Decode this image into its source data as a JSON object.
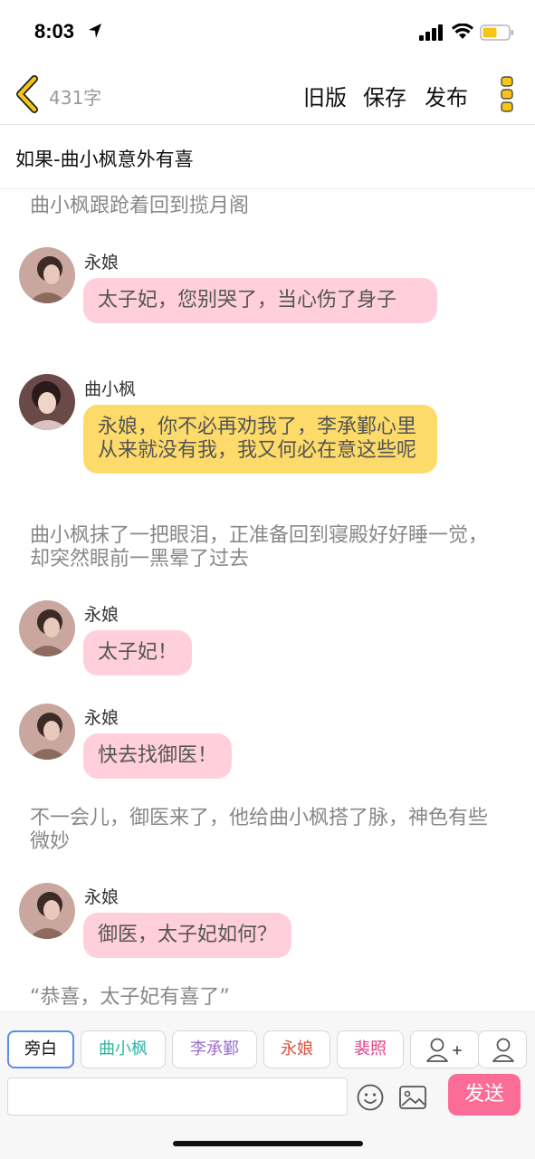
{
  "status": {
    "time": "8:03",
    "battery_color": "#f5c518"
  },
  "header": {
    "word_count": "431字",
    "old_version": "旧版",
    "save": "保存",
    "publish": "发布",
    "accent": "#f5c518"
  },
  "story": {
    "title": "如果-曲小枫意外有喜"
  },
  "chat": [
    {
      "type": "narration",
      "text": "曲小枫跟跄着回到揽月阁"
    },
    {
      "type": "message",
      "speaker": "永娘",
      "text": "太子妃，您别哭了，当心伤了身子",
      "color": "#ffd0db"
    },
    {
      "type": "message",
      "speaker": "曲小枫",
      "text": "永娘，你不必再劝我了，李承鄞心里从来就没有我，我又何必在意这些呢",
      "color": "#fddb6a"
    },
    {
      "type": "narration",
      "text": "曲小枫抹了一把眼泪，正准备回到寝殿好好睡一觉，却突然眼前一黑晕了过去"
    },
    {
      "type": "message",
      "speaker": "永娘",
      "text": "太子妃！",
      "color": "#ffd0db"
    },
    {
      "type": "message",
      "speaker": "永娘",
      "text": "快去找御医！",
      "color": "#ffd0db"
    },
    {
      "type": "narration",
      "text": "不一会儿，御医来了，他给曲小枫搭了脉，神色有些微妙"
    },
    {
      "type": "message",
      "speaker": "永娘",
      "text": "御医，太子妃如何？",
      "color": "#ffd0db"
    },
    {
      "type": "narration",
      "text": "“恭喜，太子妃有喜了”"
    }
  ],
  "roles": [
    {
      "label": "旁白",
      "color": "#111111",
      "active": true
    },
    {
      "label": "曲小枫",
      "color": "#2bb5a0",
      "active": false
    },
    {
      "label": "李承鄞",
      "color": "#9b6fd0",
      "active": false
    },
    {
      "label": "永娘",
      "color": "#e0503a",
      "active": false
    },
    {
      "label": "裴照",
      "color": "#e4408a",
      "active": false
    }
  ],
  "input": {
    "value": "",
    "placeholder": ""
  },
  "send": {
    "label": "发送",
    "color": "#fb6c96"
  }
}
